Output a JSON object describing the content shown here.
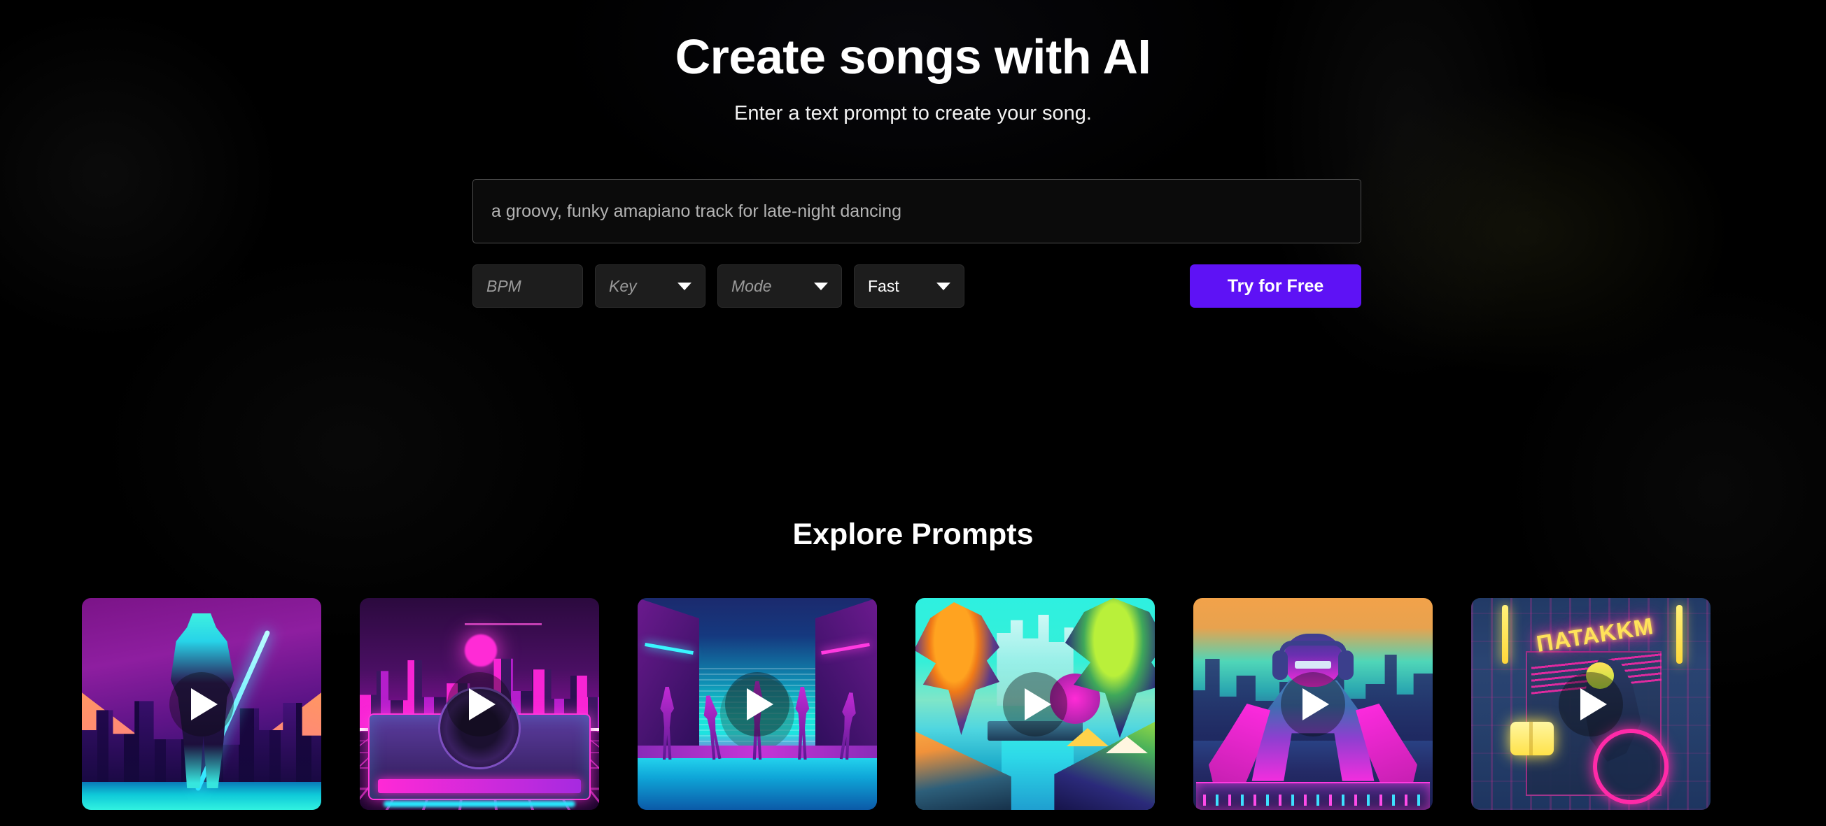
{
  "hero": {
    "title": "Create songs with AI",
    "subtitle": "Enter a text prompt to create your song."
  },
  "prompt": {
    "placeholder": "a groovy, funky amapiano track for late-night dancing",
    "value": ""
  },
  "controls": {
    "bpm": {
      "label": "BPM",
      "value": "",
      "placeholder": "BPM"
    },
    "key": {
      "label": "Key",
      "value": "",
      "placeholder": "Key"
    },
    "mode": {
      "label": "Mode",
      "value": "",
      "placeholder": "Mode"
    },
    "speed": {
      "label": "Fast",
      "value": "Fast"
    },
    "cta_label": "Try for Free"
  },
  "colors": {
    "accent": "#5e12f5",
    "background": "#000000",
    "input_border": "#4e4e4e",
    "control_bg": "#1d1d1d",
    "text_primary": "#ffffff",
    "text_muted": "#9a9a9a"
  },
  "explore": {
    "heading": "Explore Prompts",
    "cards": [
      {
        "id": "card-1",
        "alt": "neon cyberpunk samurai with glowing sword in purple city",
        "play_label": "Play"
      },
      {
        "id": "card-2",
        "alt": "synthwave DJ turntable with magenta skyline and grid floor",
        "play_label": "Play"
      },
      {
        "id": "card-3",
        "alt": "neon silhouette dancers in a teal city corridor",
        "play_label": "Play"
      },
      {
        "id": "card-4",
        "alt": "tropical neon canal with palm trees and turquoise sky",
        "play_label": "Play"
      },
      {
        "id": "card-5",
        "alt": "DJ with headphones at mixer, orange and teal sunset",
        "play_label": "Play"
      },
      {
        "id": "card-6",
        "alt": "neon storefront sign at night with cyclist",
        "sign_text": "ΠATAKKM",
        "play_label": "Play"
      }
    ]
  }
}
